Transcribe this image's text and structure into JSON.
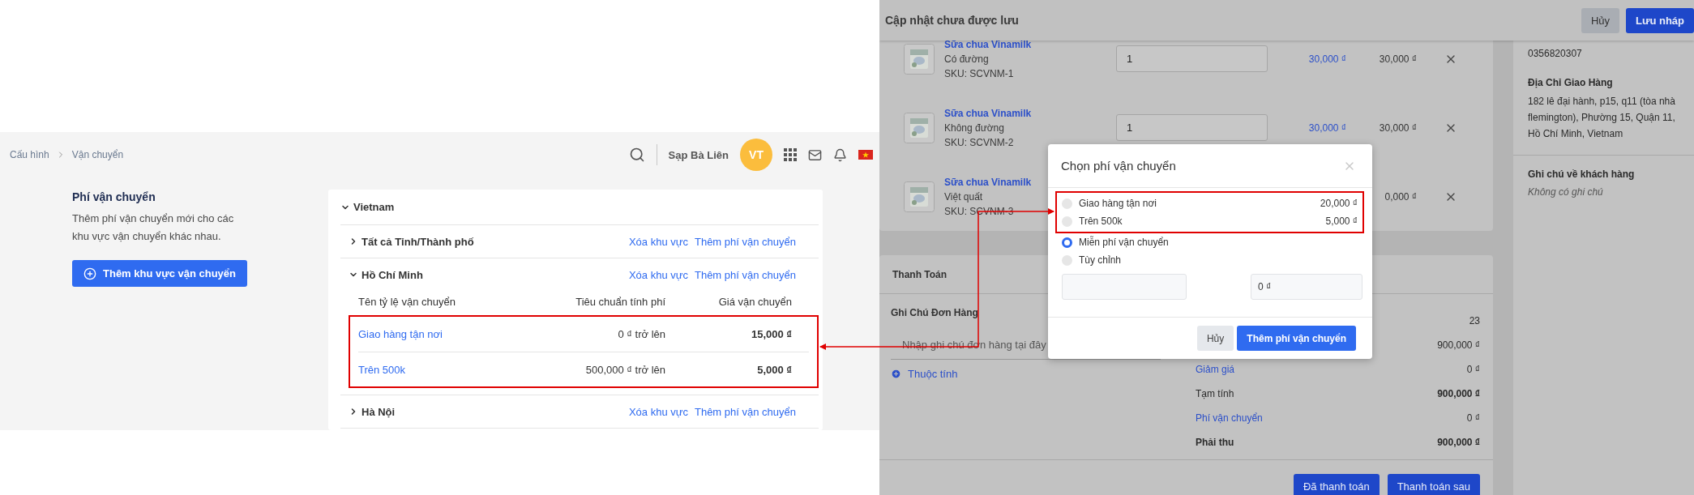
{
  "settings_page": {
    "breadcrumbs": [
      "Cấu hình",
      "Vận chuyển"
    ],
    "user": {
      "name": "Sạp Bà Liên",
      "initials": "VT"
    },
    "intro": {
      "title": "Phí vận chuyển",
      "description": "Thêm phí vận chuyển mới cho các khu vực vận chuyển khác nhau.",
      "add_button": "Thêm khu vực vận chuyển"
    },
    "country": {
      "name": "Vietnam",
      "expanded": true,
      "regions": [
        {
          "name": "Tất cả Tỉnh/Thành phố",
          "expanded": false,
          "actions": [
            "Xóa khu vực",
            "Thêm phí vận chuyển"
          ]
        },
        {
          "name": "Hồ Chí Minh",
          "expanded": true,
          "actions": [
            "Xóa khu vực",
            "Thêm phí vận chuyển"
          ],
          "columns": [
            "Tên tỷ lệ vận chuyển",
            "Tiêu chuẩn tính phí",
            "Giá vận chuyển"
          ],
          "highlighted": true,
          "rates": [
            {
              "name": "Giao hàng tận nơi",
              "condition": "0 ₫ trở lên",
              "price": "15,000 ₫"
            },
            {
              "name": "Trên 500k",
              "condition": "500,000 ₫ trở lên",
              "price": "5,000 ₫"
            }
          ]
        },
        {
          "name": "Hà Nội",
          "expanded": false,
          "actions": [
            "Xóa khu vực",
            "Thêm phí vận chuyển"
          ]
        }
      ]
    }
  },
  "order_page": {
    "title": "Cập nhật chưa được lưu",
    "header_buttons": [
      {
        "label": "Hủy",
        "kind": "secondary"
      },
      {
        "label": "Lưu nháp",
        "kind": "primary"
      }
    ],
    "products": [
      {
        "name": "Sữa chua Vinamilk",
        "variant": "Có đường",
        "sku": "SKU: SCVNM-1",
        "quantity": "1",
        "price": "30,000 ₫",
        "total": "30,000 ₫"
      },
      {
        "name": "Sữa chua Vinamilk",
        "variant": "Không đường",
        "sku": "SKU: SCVNM-2",
        "quantity": "1",
        "price": "30,000 ₫",
        "total": "30,000 ₫"
      },
      {
        "name": "Sữa chua Vinamilk",
        "variant": "Việt quất",
        "sku": "SKU: SCVNM-3",
        "total": "0,000 ₫"
      }
    ],
    "customer": {
      "phone": "0356820307",
      "address_title": "Địa Chỉ Giao Hàng",
      "address": "182 lê đại hành, p15, q11 (tòa nhà flemington), Phường 15, Quận 11, Hồ Chí Minh, Vietnam",
      "note_title": "Ghi chú về khách hàng",
      "note": "Không có ghi chú"
    },
    "payment": {
      "title": "Thanh Toán",
      "note_label": "Ghi Chú Đơn Hàng",
      "note_placeholder": "Nhập ghi chú đơn hàng tại đây",
      "attributes_link": "Thuộc tính",
      "summary": [
        {
          "kind": "plain",
          "value": "23"
        },
        {
          "kind": "plain",
          "value": "900,000 ₫"
        },
        {
          "kind": "link",
          "label": "Giảm giá",
          "value": "0 ₫"
        },
        {
          "kind": "plain",
          "label": "Tạm tính",
          "value": "900,000 ₫"
        },
        {
          "kind": "link",
          "label": "Phí vận chuyển",
          "value": "0 ₫"
        },
        {
          "kind": "total",
          "label": "Phải thu",
          "value": "900,000 ₫"
        }
      ],
      "buttons": [
        "Đã thanh toán",
        "Thanh toán sau"
      ]
    }
  },
  "shipping_modal": {
    "title": "Chọn phí vận chuyển",
    "highlighted": true,
    "rate_options": [
      {
        "label": "Giao hàng tận nơi",
        "price": "20,000 ₫",
        "selected": false
      },
      {
        "label": "Trên 500k",
        "price": "5,000 ₫",
        "selected": false
      }
    ],
    "other_options": [
      {
        "label": "Miễn phí vận chuyển",
        "selected": true
      },
      {
        "label": "Tùy chỉnh",
        "selected": false
      }
    ],
    "custom_price": "0 ₫",
    "buttons": [
      {
        "label": "Hủy",
        "kind": "secondary"
      },
      {
        "label": "Thêm phí vận chuyển",
        "kind": "primary"
      }
    ]
  }
}
